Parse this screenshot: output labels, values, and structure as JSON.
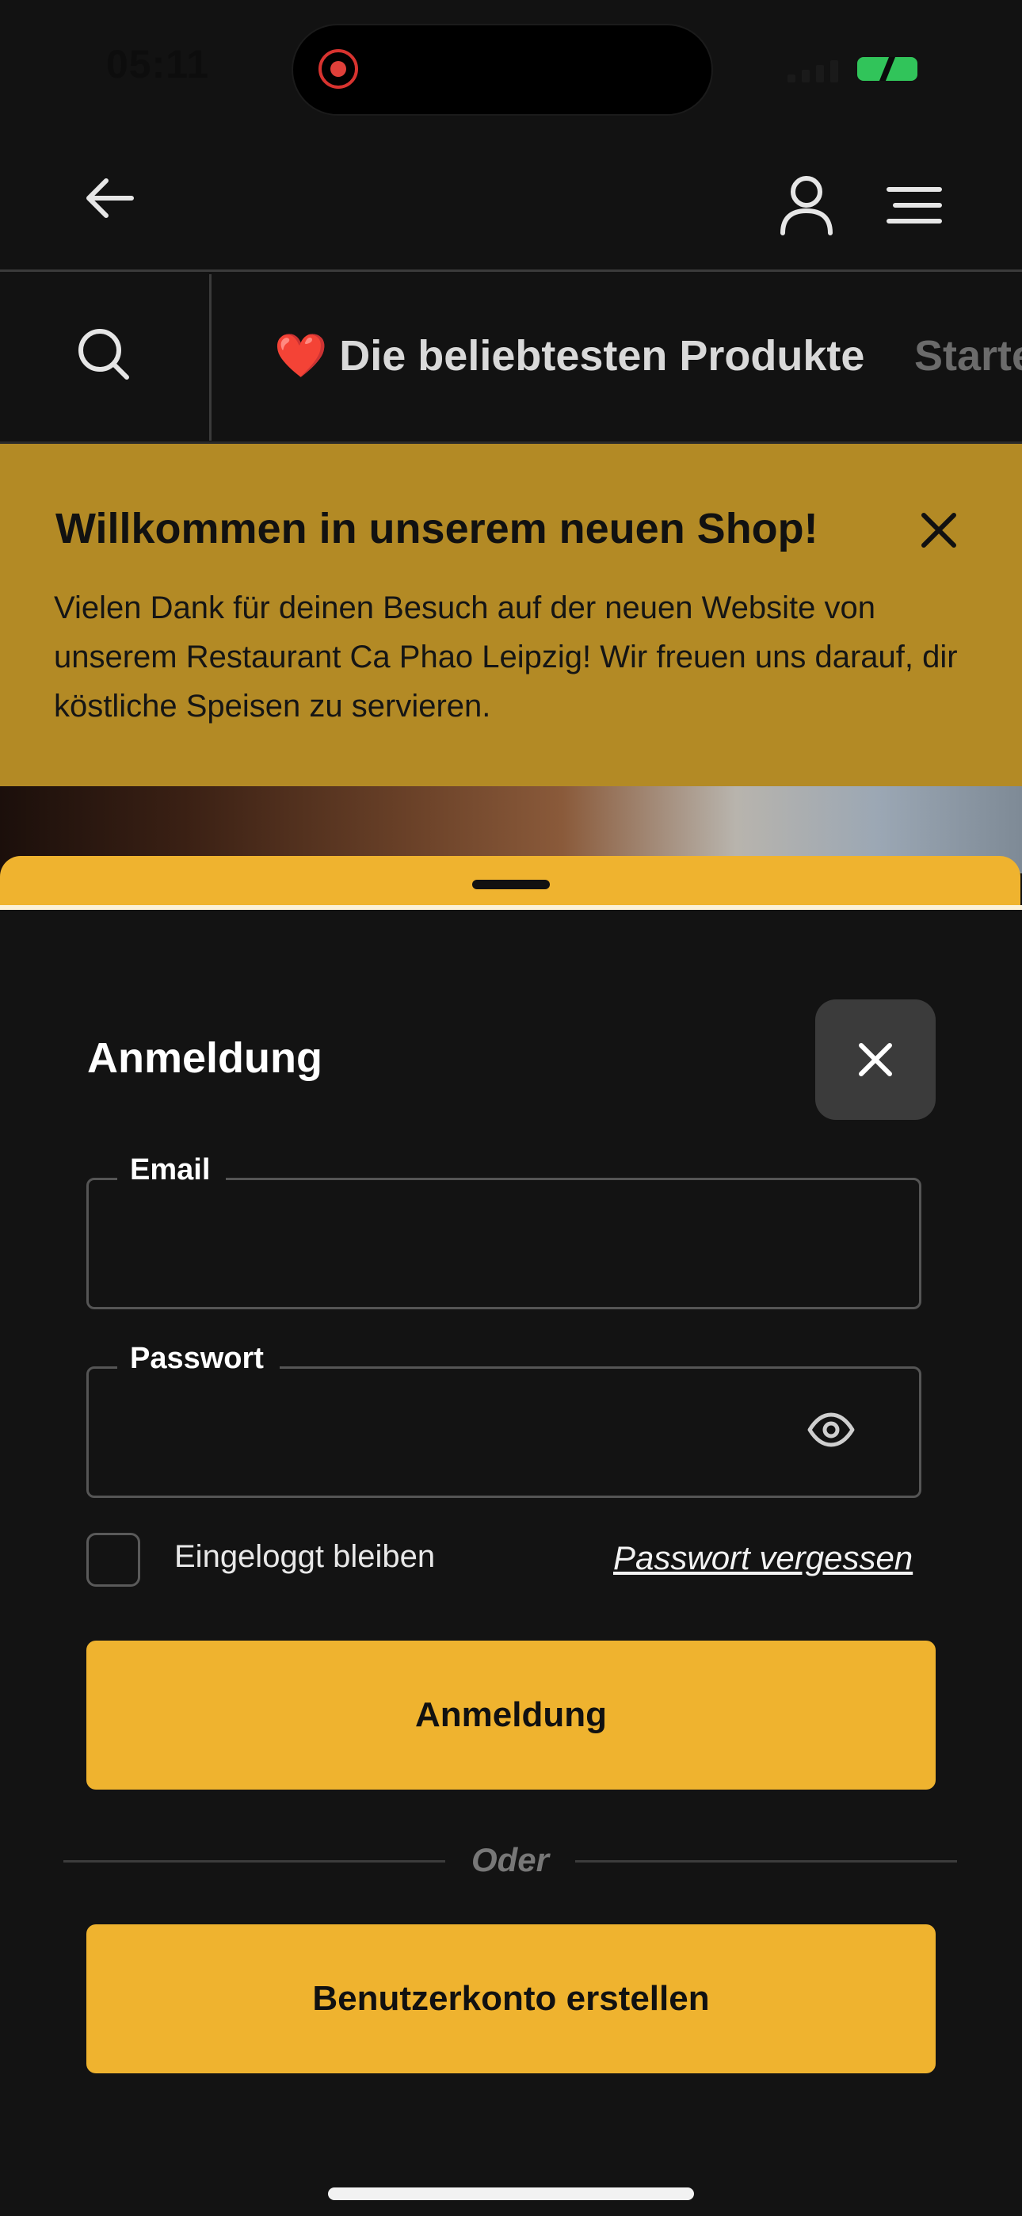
{
  "status_bar": {
    "time": "05:11"
  },
  "header": {
    "back_icon": "arrow-left-icon",
    "account_icon": "user-icon",
    "menu_icon": "hamburger-icon"
  },
  "category_bar": {
    "search_icon": "search-icon",
    "active": {
      "emoji": "❤️",
      "label": "Die beliebtesten Produkte"
    },
    "next": {
      "label": "Starte"
    }
  },
  "banner": {
    "title": "Willkommen in unserem neuen Shop!",
    "text": "Vielen Dank für deinen Besuch auf der neuen Website von unserem Restaurant Ca Phao Leipzig! Wir freuen uns darauf, dir köstliche Speisen zu servieren."
  },
  "login_sheet": {
    "title": "Anmeldung",
    "email_label": "Email",
    "email_value": "",
    "password_label": "Passwort",
    "password_value": "",
    "remember_label": "Eingeloggt bleiben",
    "remember_checked": false,
    "forgot_label": "Passwort vergessen",
    "login_button": "Anmeldung",
    "divider_text": "Oder",
    "register_button": "Benutzerkonto erstellen"
  },
  "colors": {
    "accent": "#efb32f",
    "banner": "#b38a25",
    "background": "#121212"
  }
}
